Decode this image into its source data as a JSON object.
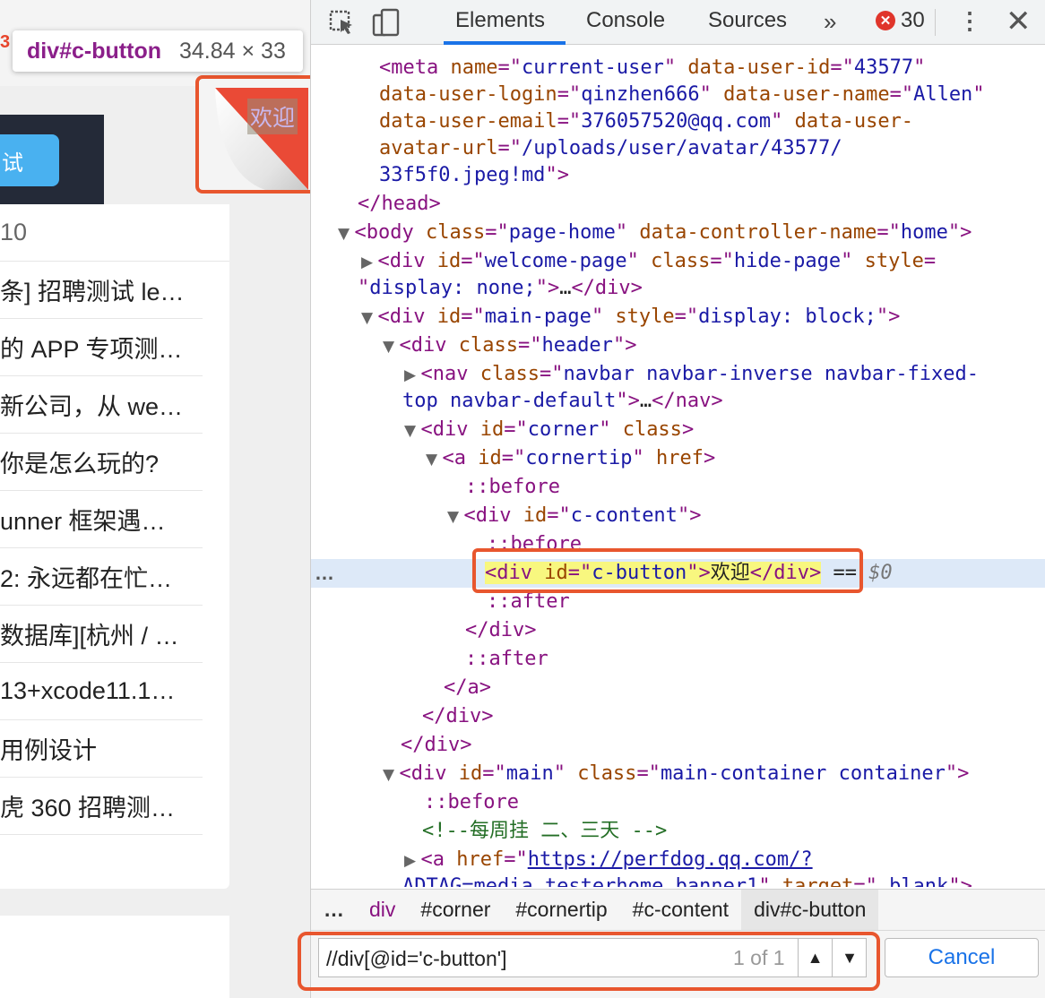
{
  "page": {
    "top_char": "3",
    "tooltip": {
      "selector": "div#c-button",
      "size": "34.84 × 33"
    },
    "banner_button": "试",
    "corner_text": "欢迎",
    "list_header": "10",
    "list_items": [
      "条] 招聘测试 le…",
      "的 APP 专项测…",
      "新公司，从 we…",
      "你是怎么玩的?",
      "unner 框架遇…",
      "2: 永远都在忙…",
      "数据库][杭州 / …",
      "13+xcode11.1…",
      "用例设计",
      "虎 360 招聘测…"
    ]
  },
  "devtools": {
    "tabs": [
      "Elements",
      "Console",
      "Sources"
    ],
    "more_tabs": "»",
    "error_badge": "✕",
    "error_count": "30",
    "kebab": "⋮",
    "close": "✕",
    "tree": {
      "r0": {
        "t": "<meta",
        "a1": " name",
        "e": "=\"",
        "v1": "current-user",
        "q": "\"",
        "a2": " data-user-id",
        "v2": "43577"
      },
      "r1": {
        "a1": "data-user-login",
        "v1": "qinzhen666",
        "a2": " data-user-name",
        "v2": "Allen"
      },
      "r2": {
        "a1": "data-user-email",
        "v1": "376057520@qq.com",
        "a2": " data-user-"
      },
      "r3": {
        "a1": "avatar-url",
        "v1": "/uploads/user/avatar/43577/"
      },
      "r4": {
        "v1": "33f5f0.jpeg!md",
        "end": ">"
      },
      "r5": {
        "t": "</head>"
      },
      "r6": {
        "t": "<body",
        "a1": " class",
        "v1": "page-home",
        "a2": " data-controller-name",
        "v2": "home",
        "end": ">"
      },
      "r7": {
        "t": "<div",
        "a1": " id",
        "v1": "welcome-page",
        "a2": " class",
        "v2": "hide-page",
        "a3": " style",
        "eq": "="
      },
      "r8": {
        "v1": "display: none;",
        "end": ">",
        "tx": "…",
        "close": "</div>"
      },
      "r9": {
        "t": "<div",
        "a1": " id",
        "v1": "main-page",
        "a2": " style",
        "v2": "display: block;",
        "end": ">"
      },
      "r10": {
        "t": "<div",
        "a1": " class",
        "v1": "header",
        "end": ">"
      },
      "r11": {
        "t": "<nav",
        "a1": " class",
        "v1": "navbar navbar-inverse navbar-fixed-"
      },
      "r12": {
        "v1": "top navbar-default",
        "end": ">",
        "tx": "…",
        "close": "</nav>"
      },
      "r13": {
        "t": "<div",
        "a1": " id",
        "v1": "corner",
        "a2": " class",
        "end": ">"
      },
      "r14": {
        "t": "<a",
        "a1": " id",
        "v1": "cornertip",
        "a2": " href",
        "end": ">"
      },
      "r15": {
        "pe": "::before"
      },
      "r16": {
        "t": "<div",
        "a1": " id",
        "v1": "c-content",
        "end": ">"
      },
      "r17": {
        "pe": "::before"
      },
      "r18": {
        "t": "<div",
        "a1": " id",
        "v1": "c-button",
        "end": ">",
        "tx": "欢迎",
        "close": "</div>",
        "eq0": " == ",
        "dollar": "$0",
        "dots": "…"
      },
      "r19": {
        "pe": "::after"
      },
      "r20": {
        "t": "</div>"
      },
      "r21": {
        "pe": "::after"
      },
      "r22": {
        "t": "</a>"
      },
      "r23": {
        "t": "</div>"
      },
      "r24": {
        "t": "</div>"
      },
      "r25": {
        "t": "<div",
        "a1": " id",
        "v1": "main",
        "a2": " class",
        "v2": "main-container container",
        "end": ">"
      },
      "r26": {
        "pe": "::before"
      },
      "r27": {
        "cm": "<!--每周挂 二、三天 -->"
      },
      "r28": {
        "t": "<a",
        "a1": " href",
        "lk": "https://perfdog.qq.com/?"
      },
      "r29": {
        "v1": "ADTAG=media_testerhome_banner1",
        "a2": " target",
        "v2": "_blank",
        "end": ">"
      }
    },
    "breadcrumb": [
      "…",
      "div",
      "#corner",
      "#cornertip",
      "#c-content",
      "div#c-button"
    ],
    "search": {
      "value": "//div[@id='c-button']",
      "count": "1 of 1",
      "prev": "▲",
      "next": "▼",
      "cancel": "Cancel"
    }
  },
  "colors": {
    "highlight_box": "#e8562e",
    "selected_row": "#dde9f8",
    "tag": "#881280",
    "attr_name": "#994500",
    "attr_value": "#1a1aa6",
    "accent": "#1a73e8"
  }
}
